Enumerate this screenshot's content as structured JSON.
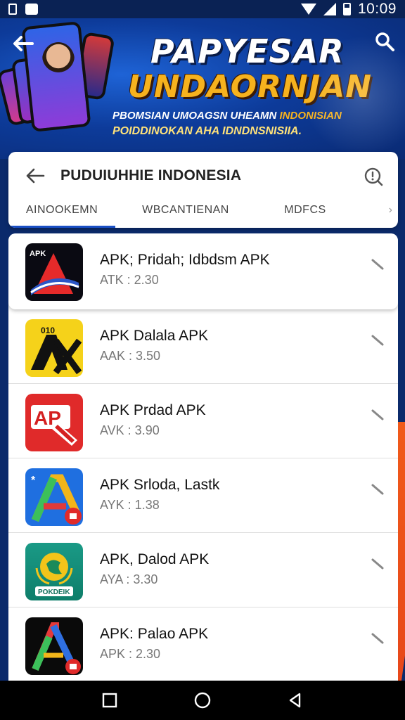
{
  "status_bar": {
    "time": "10:09",
    "icons": [
      "sim-icon",
      "photo-icon",
      "wifi-icon",
      "signal-icon",
      "battery-icon"
    ]
  },
  "banner": {
    "headline_line1": "PAPYESAR",
    "headline_line2": "UNDAORNJAN",
    "sub_line1_white": "PBOMSIAN UMOAGSN UHEAMN ",
    "sub_line1_highlight": "INDONISIAN",
    "sub_line2": "POIDDINOKAN AHA IDNDNSNISIIA.",
    "icons": [
      "back-arrow-icon",
      "search-icon"
    ]
  },
  "header": {
    "title": "PUDUIUHHIE INDONESIA",
    "tabs": [
      {
        "label": "AINOOKEMN",
        "active": true
      },
      {
        "label": "WBCANTIENAN",
        "active": false
      },
      {
        "label": "MDFCS",
        "active": false
      }
    ]
  },
  "apps": [
    {
      "name": "APK; Pridah; Idbdsm APK",
      "meta": "ATK : 2.30",
      "icon": "apk-a-flag-icon"
    },
    {
      "name": "APK Dalala APK",
      "meta": "AAK : 3.50",
      "icon": "apk-yellow-ax-icon"
    },
    {
      "name": "APK Prdad APK",
      "meta": "AVK : 3.90",
      "icon": "apk-red-ap-icon"
    },
    {
      "name": "APK Srloda, Lastk",
      "meta": "AYK : 1.38",
      "icon": "apk-blue-a-icon"
    },
    {
      "name": "APK, Dalod APK",
      "meta": "AYA : 3.30",
      "icon": "apk-green-globe-icon"
    },
    {
      "name": "APK: Palao APK",
      "meta": "APK : 2.30",
      "icon": "apk-black-a-icon"
    }
  ],
  "app_icon_badges": {
    "apk-green-globe-icon": "POKDEIK"
  },
  "colors": {
    "banner_blue": "#0d3b9a",
    "headline_gold": "#f6b21e",
    "tab_indicator": "#1a4fc4",
    "accent_orange": "#f05a1a"
  }
}
